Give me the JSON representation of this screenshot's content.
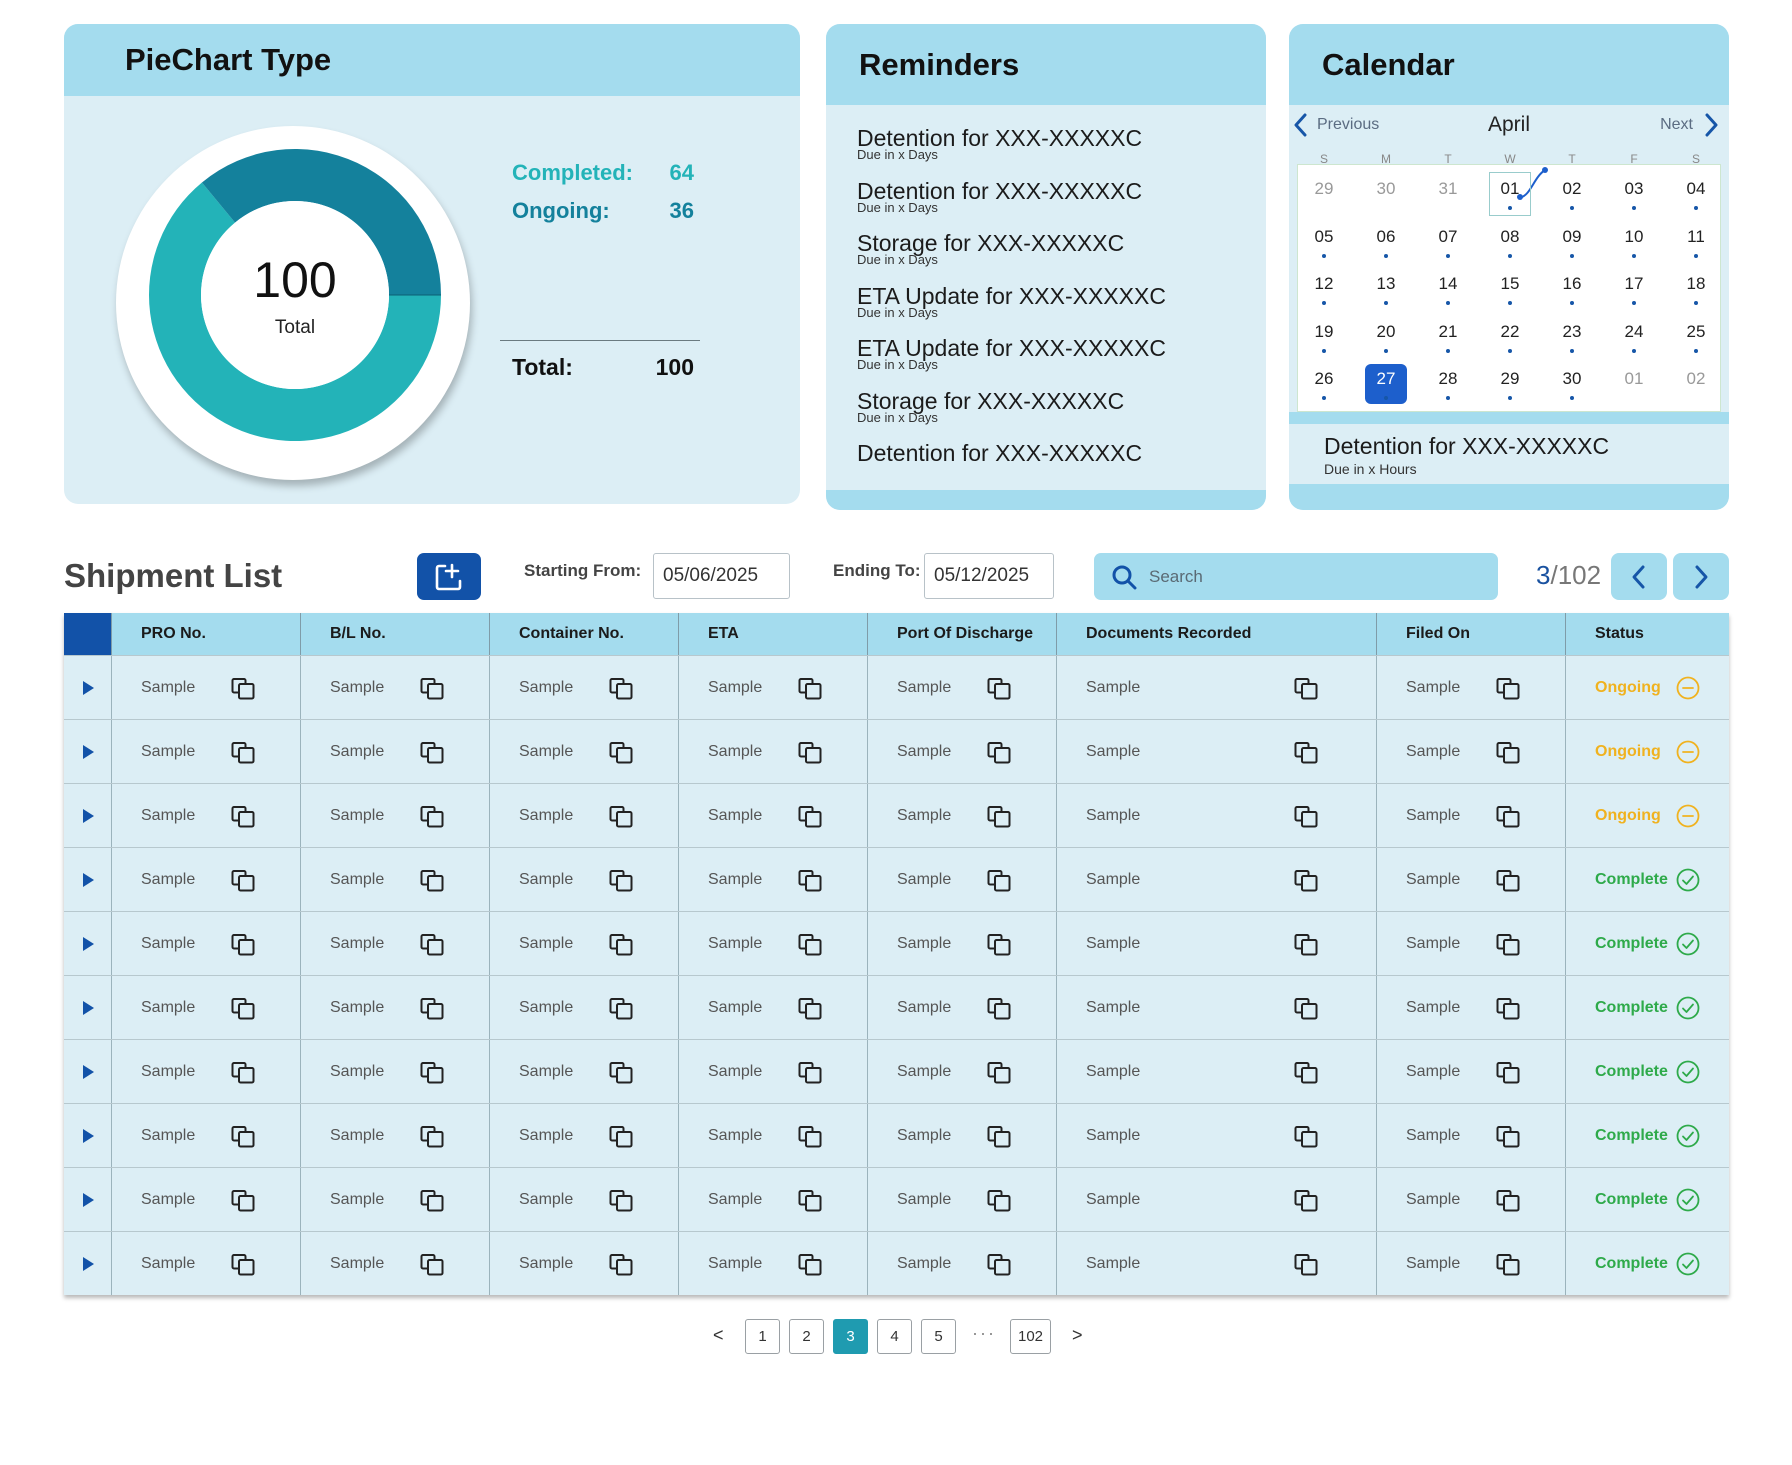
{
  "pie_card": {
    "title": "PieChart Type",
    "center_value": "100",
    "center_label": "Total",
    "completed_label": "Completed:",
    "completed_value": "64",
    "ongoing_label": "Ongoing:",
    "ongoing_value": "36",
    "total_label": "Total:",
    "total_value": "100",
    "colors": {
      "completed": "#23b3b8",
      "ongoing": "#14819c"
    }
  },
  "chart_data": {
    "type": "pie",
    "categories": [
      "Completed",
      "Ongoing"
    ],
    "values": [
      64,
      36
    ],
    "title": "PieChart Type"
  },
  "reminders": {
    "title": "Reminders",
    "items": [
      {
        "title": "Detention for XXX-XXXXXC",
        "sub": "Due in x Days"
      },
      {
        "title": "Detention for XXX-XXXXXC",
        "sub": "Due in x Days"
      },
      {
        "title": "Storage for XXX-XXXXXC",
        "sub": "Due in x Days"
      },
      {
        "title": "ETA Update for XXX-XXXXXC",
        "sub": "Due in x Days"
      },
      {
        "title": "ETA Update for XXX-XXXXXC",
        "sub": "Due in x Days"
      },
      {
        "title": "Storage for XXX-XXXXXC",
        "sub": "Due in x Days"
      },
      {
        "title": "Detention for XXX-XXXXXC",
        "sub": ""
      }
    ]
  },
  "calendar": {
    "title": "Calendar",
    "prev_label": "Previous",
    "next_label": "Next",
    "month": "April",
    "weekdays": [
      "S",
      "M",
      "T",
      "W",
      "T",
      "F",
      "S"
    ],
    "weeks": [
      [
        "29",
        "30",
        "31",
        "01",
        "02",
        "03",
        "04"
      ],
      [
        "05",
        "06",
        "07",
        "08",
        "09",
        "10",
        "11"
      ],
      [
        "12",
        "13",
        "14",
        "15",
        "16",
        "17",
        "18"
      ],
      [
        "19",
        "20",
        "21",
        "22",
        "23",
        "24",
        "25"
      ],
      [
        "26",
        "27",
        "28",
        "29",
        "30",
        "01",
        "02"
      ]
    ],
    "selected_day": "27",
    "event_title": "Detention for XXX-XXXXXC",
    "event_sub": "Due in x Hours"
  },
  "shipments": {
    "title": "Shipment List",
    "starting_label": "Starting From:",
    "starting_value": "05/06/2025",
    "ending_label": "Ending To:",
    "ending_value": "05/12/2025",
    "search_placeholder": "Search",
    "page_current": "3",
    "page_total": "/102",
    "columns": [
      "PRO No.",
      "B/L No.",
      "Container No.",
      "ETA",
      "Port Of Discharge",
      "Documents Recorded",
      "Filed On",
      "Status"
    ],
    "rows": [
      {
        "cells": [
          "Sample",
          "Sample",
          "Sample",
          "Sample",
          "Sample",
          "Sample",
          "Sample"
        ],
        "status": "Ongoing"
      },
      {
        "cells": [
          "Sample",
          "Sample",
          "Sample",
          "Sample",
          "Sample",
          "Sample",
          "Sample"
        ],
        "status": "Ongoing"
      },
      {
        "cells": [
          "Sample",
          "Sample",
          "Sample",
          "Sample",
          "Sample",
          "Sample",
          "Sample"
        ],
        "status": "Ongoing"
      },
      {
        "cells": [
          "Sample",
          "Sample",
          "Sample",
          "Sample",
          "Sample",
          "Sample",
          "Sample"
        ],
        "status": "Complete"
      },
      {
        "cells": [
          "Sample",
          "Sample",
          "Sample",
          "Sample",
          "Sample",
          "Sample",
          "Sample"
        ],
        "status": "Complete"
      },
      {
        "cells": [
          "Sample",
          "Sample",
          "Sample",
          "Sample",
          "Sample",
          "Sample",
          "Sample"
        ],
        "status": "Complete"
      },
      {
        "cells": [
          "Sample",
          "Sample",
          "Sample",
          "Sample",
          "Sample",
          "Sample",
          "Sample"
        ],
        "status": "Complete"
      },
      {
        "cells": [
          "Sample",
          "Sample",
          "Sample",
          "Sample",
          "Sample",
          "Sample",
          "Sample"
        ],
        "status": "Complete"
      },
      {
        "cells": [
          "Sample",
          "Sample",
          "Sample",
          "Sample",
          "Sample",
          "Sample",
          "Sample"
        ],
        "status": "Complete"
      },
      {
        "cells": [
          "Sample",
          "Sample",
          "Sample",
          "Sample",
          "Sample",
          "Sample",
          "Sample"
        ],
        "status": "Complete"
      }
    ]
  },
  "pager": {
    "pages": [
      "1",
      "2",
      "3",
      "4",
      "5"
    ],
    "ellipsis": "···",
    "last_page": "102",
    "active_page": "3",
    "prev_symbol": "<",
    "next_symbol": ">"
  },
  "icons": {
    "add": "add-shipment-icon",
    "search": "search-icon",
    "copy": "copy-icon",
    "expand": "expand-row-icon",
    "ongoing": "minus-circle-icon",
    "complete": "check-circle-icon"
  },
  "colors": {
    "header_blue": "#a4dcee",
    "panel_bg": "#dceef5",
    "accent_dark": "#1252a8",
    "ongoing": "#f0b21f",
    "complete": "#2eaa4a"
  }
}
